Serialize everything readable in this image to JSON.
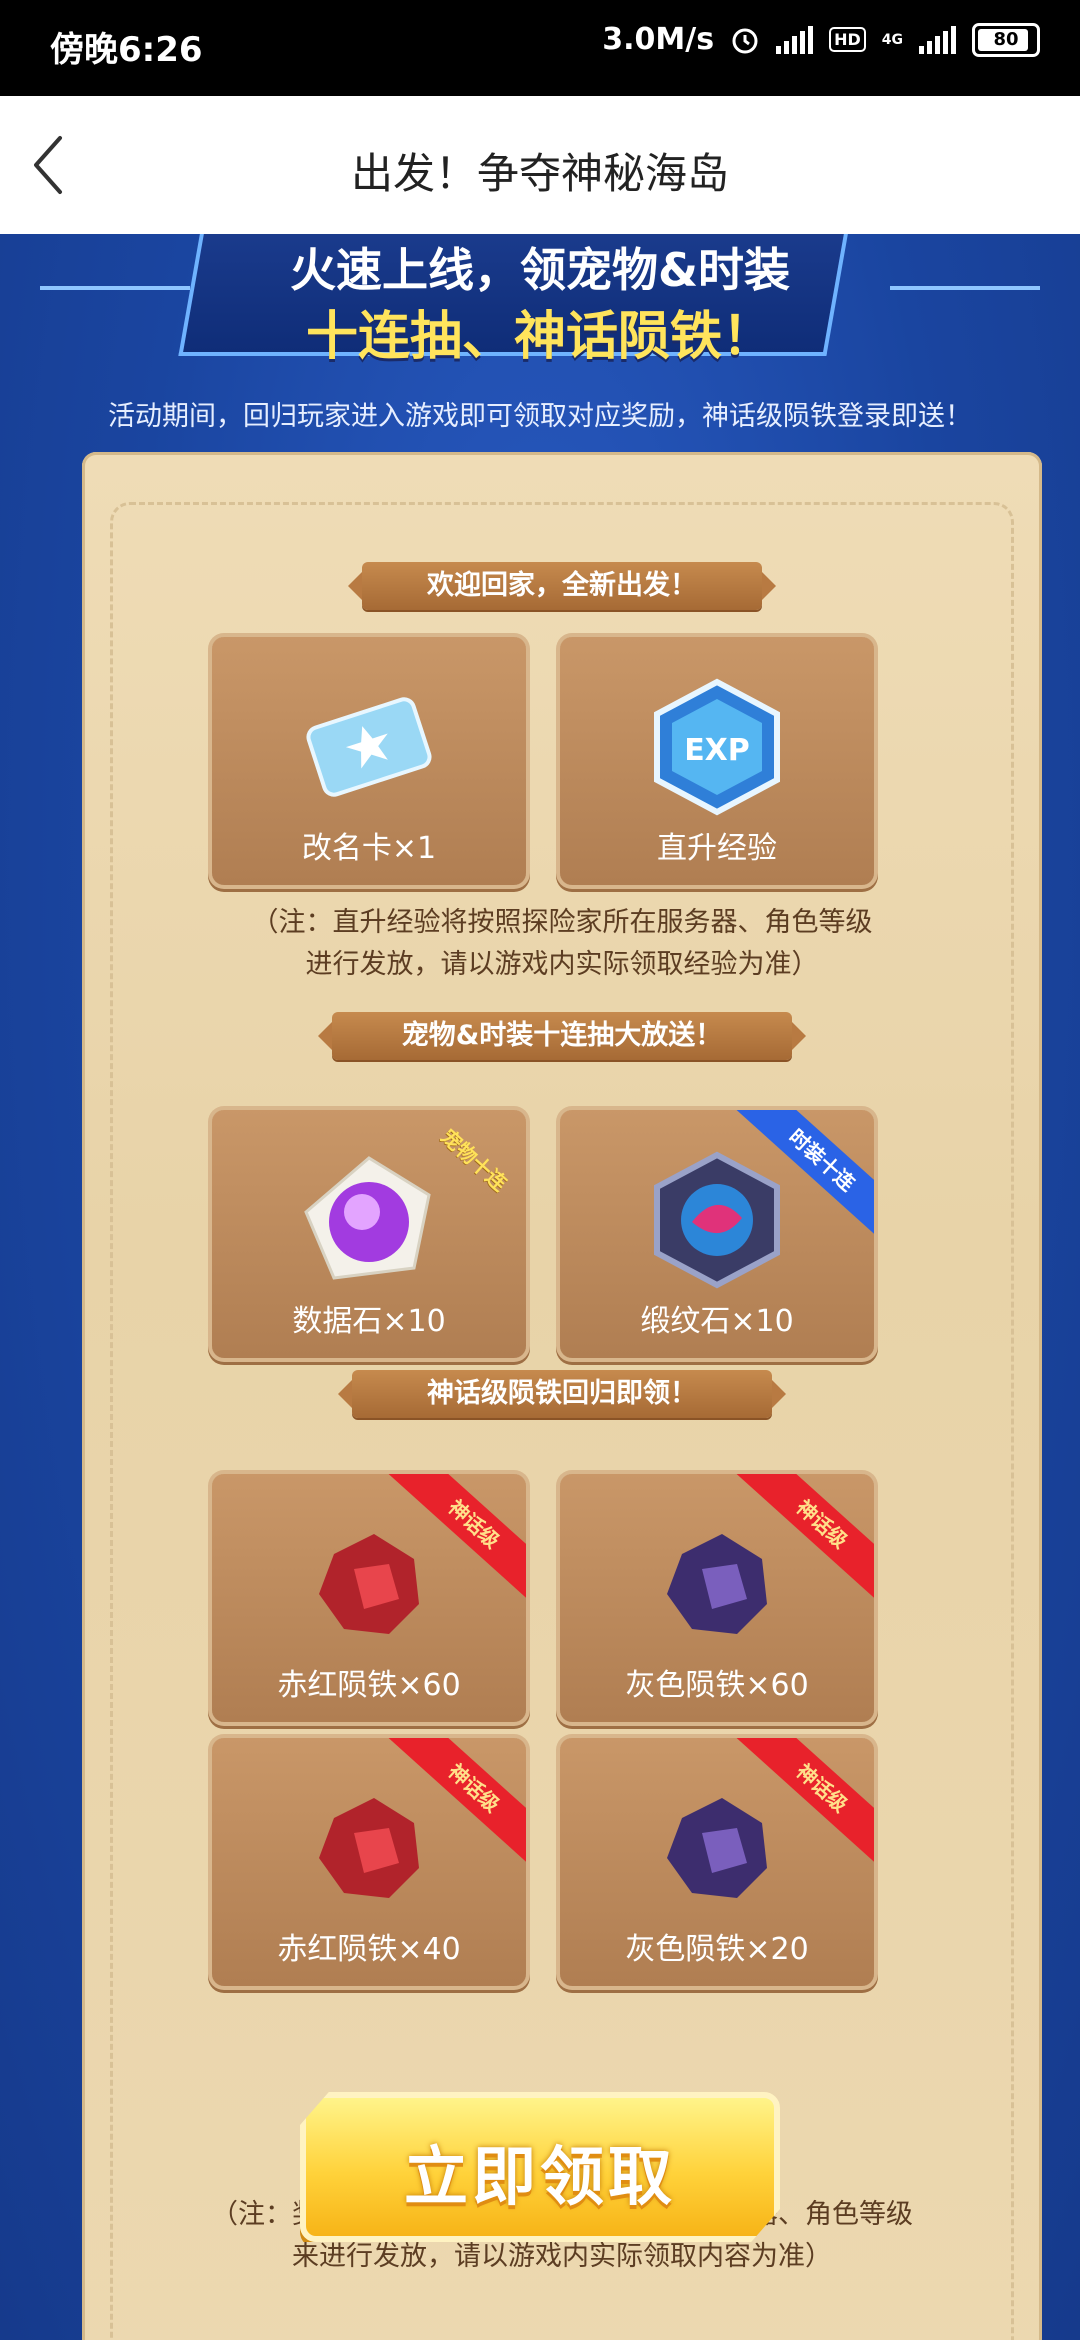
{
  "status_bar": {
    "time": "傍晚6:26",
    "speed": "3.0M/s",
    "hd": "HD",
    "network": "4G",
    "battery": "80"
  },
  "header": {
    "title": "出发！争夺神秘海岛"
  },
  "banner": {
    "line1": "火速上线，领宠物&时装",
    "line2": "十连抽、神话陨铁！",
    "subline": "活动期间，回归玩家进入游戏即可领取对应奖励，神话级陨铁登录即送！"
  },
  "sections": [
    {
      "label": "欢迎回家，全新出发！",
      "cards": [
        {
          "label": "改名卡×1",
          "icon": "rename-card-icon"
        },
        {
          "label": "直升经验",
          "icon": "exp-icon"
        }
      ],
      "note_line1": "（注：直升经验将按照探险家所在服务器、角色等级",
      "note_line2": "进行发放，请以游戏内实际领取经验为准）"
    },
    {
      "label": "宠物&时装十连抽大放送！",
      "cards": [
        {
          "label": "数据石×10",
          "icon": "data-stone-icon",
          "ribbon": "宠物十连"
        },
        {
          "label": "缎纹石×10",
          "icon": "satin-stone-icon",
          "ribbon": "时装十连"
        }
      ]
    },
    {
      "label": "神话级陨铁回归即领！",
      "cards": [
        {
          "label": "赤红陨铁×60",
          "icon": "red-meteorite-icon",
          "ribbon": "神话级"
        },
        {
          "label": "灰色陨铁×60",
          "icon": "gray-meteorite-icon",
          "ribbon": "神话级"
        },
        {
          "label": "赤红陨铁×40",
          "icon": "red-meteorite-icon",
          "ribbon": "神话级"
        },
        {
          "label": "灰色陨铁×20",
          "icon": "gray-meteorite-icon",
          "ribbon": "神话级"
        }
      ],
      "note_line1": "（注：奖励类型、数量将按照探险家所在服务器、角色等级",
      "note_line2": "来进行发放，请以游戏内实际领取内容为准）"
    }
  ],
  "claim_button": "立即领取",
  "colors": {
    "page_background": "#1c4aa8",
    "scroll_paper": "#ecd8b0",
    "card": "#c99768",
    "ribbon_red": "#e8222b",
    "ribbon_blue": "#2a63e6",
    "claim_button": "#ffd23a"
  }
}
